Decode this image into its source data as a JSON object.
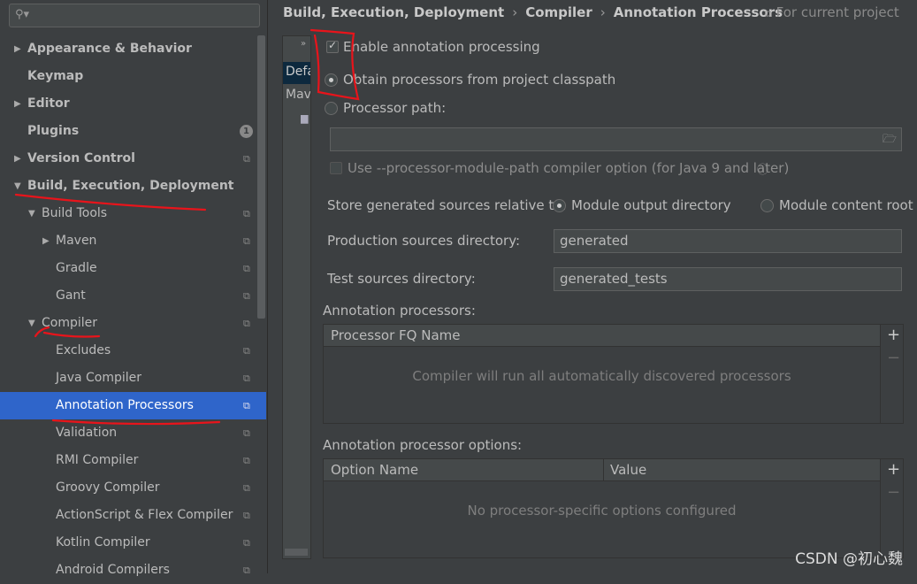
{
  "search": {
    "icon": "search-icon",
    "placeholder": ""
  },
  "sidebar": {
    "items": [
      {
        "label": "Appearance & Behavior",
        "level": 0,
        "bold": true,
        "arrow": "right"
      },
      {
        "label": "Keymap",
        "level": 0,
        "bold": true
      },
      {
        "label": "Editor",
        "level": 0,
        "bold": true,
        "arrow": "right"
      },
      {
        "label": "Plugins",
        "level": 0,
        "bold": true,
        "badge": "1"
      },
      {
        "label": "Version Control",
        "level": 0,
        "bold": true,
        "arrow": "right",
        "copy": true
      },
      {
        "label": "Build, Execution, Deployment",
        "level": 0,
        "bold": true,
        "arrow": "down"
      },
      {
        "label": "Build Tools",
        "level": 1,
        "arrow": "down",
        "copy": true
      },
      {
        "label": "Maven",
        "level": 2,
        "arrow": "right",
        "copy": true
      },
      {
        "label": "Gradle",
        "level": 2,
        "copy": true
      },
      {
        "label": "Gant",
        "level": 2,
        "copy": true
      },
      {
        "label": "Compiler",
        "level": 1,
        "arrow": "down",
        "copy": true
      },
      {
        "label": "Excludes",
        "level": 2,
        "copy": true
      },
      {
        "label": "Java Compiler",
        "level": 2,
        "copy": true
      },
      {
        "label": "Annotation Processors",
        "level": 2,
        "copy": true,
        "selected": true
      },
      {
        "label": "Validation",
        "level": 2,
        "copy": true
      },
      {
        "label": "RMI Compiler",
        "level": 2,
        "copy": true
      },
      {
        "label": "Groovy Compiler",
        "level": 2,
        "copy": true
      },
      {
        "label": "ActionScript & Flex Compiler",
        "level": 2,
        "copy": true
      },
      {
        "label": "Kotlin Compiler",
        "level": 2,
        "copy": true
      },
      {
        "label": "Android Compilers",
        "level": 2,
        "copy": true
      }
    ]
  },
  "breadcrumb": [
    "Build, Execution, Deployment",
    "Compiler",
    "Annotation Processors"
  ],
  "scope_label": "For current project",
  "profiles": {
    "expand": "»",
    "items": [
      "Default",
      "Maven"
    ]
  },
  "settings": {
    "enable_label": "Enable annotation processing",
    "enable_checked": true,
    "obtain_label": "Obtain processors from project classpath",
    "path_label": "Processor path:",
    "selected_source": "obtain",
    "path_value": "",
    "module_path_label": "Use --processor-module-path compiler option (for Java 9 and later)",
    "store_label": "Store generated sources relative to:",
    "store_opt1": "Module output directory",
    "store_opt2": "Module content root",
    "store_selected": "opt1",
    "prod_label": "Production sources directory:",
    "prod_value": "generated",
    "test_label": "Test sources directory:",
    "test_value": "generated_tests"
  },
  "processors": {
    "title": "Annotation processors:",
    "col": "Processor FQ Name",
    "empty": "Compiler will run all automatically discovered processors",
    "add": "+",
    "remove": "−"
  },
  "options": {
    "title": "Annotation processor options:",
    "col1": "Option Name",
    "col2": "Value",
    "empty": "No processor-specific options configured",
    "add": "+",
    "remove": "−"
  },
  "watermark": "CSDN @初心魏",
  "colors": {
    "selection": "#2f65ca",
    "annotation": "#e8141b"
  }
}
